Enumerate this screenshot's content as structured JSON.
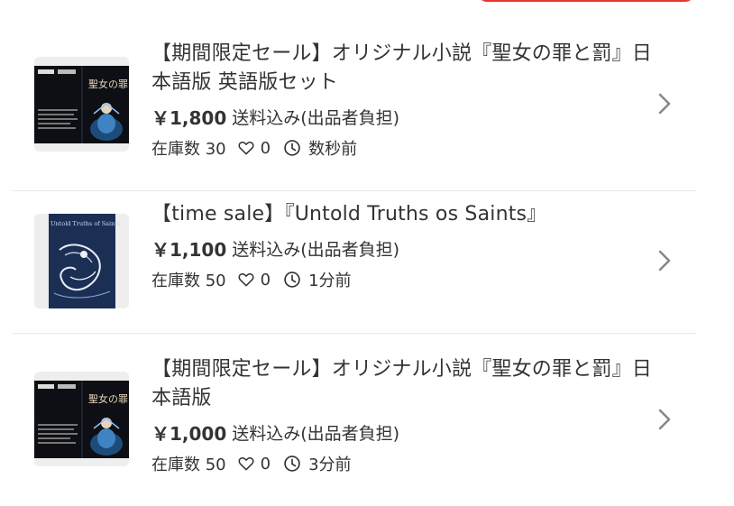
{
  "listings": [
    {
      "title": "【期間限定セール】オリジナル小説『聖女の罪と罰』日本語版 英語版セット",
      "price": "￥1,800",
      "shipping": "送料込み(出品者負担)",
      "stock": "在庫数 30",
      "likes": "0",
      "time": "数秒前",
      "cover_title": "聖女の罪と罰"
    },
    {
      "title": "【time sale】『Untold Truths os Saints』",
      "price": "￥1,100",
      "shipping": "送料込み(出品者負担)",
      "stock": "在庫数 50",
      "likes": "0",
      "time": "1分前",
      "cover_title": "Untold Truths of Saints"
    },
    {
      "title": "【期間限定セール】オリジナル小説『聖女の罪と罰』日本語版",
      "price": "￥1,000",
      "shipping": "送料込み(出品者負担)",
      "stock": "在庫数 50",
      "likes": "0",
      "time": "3分前",
      "cover_title": "聖女の罪と罰"
    }
  ],
  "icons": {
    "like": "heart-icon",
    "time": "clock-icon",
    "open": "chevron-right-icon"
  },
  "colors": {
    "accent": "#ea352d",
    "divider": "#e8e8e8",
    "text": "#333333"
  }
}
